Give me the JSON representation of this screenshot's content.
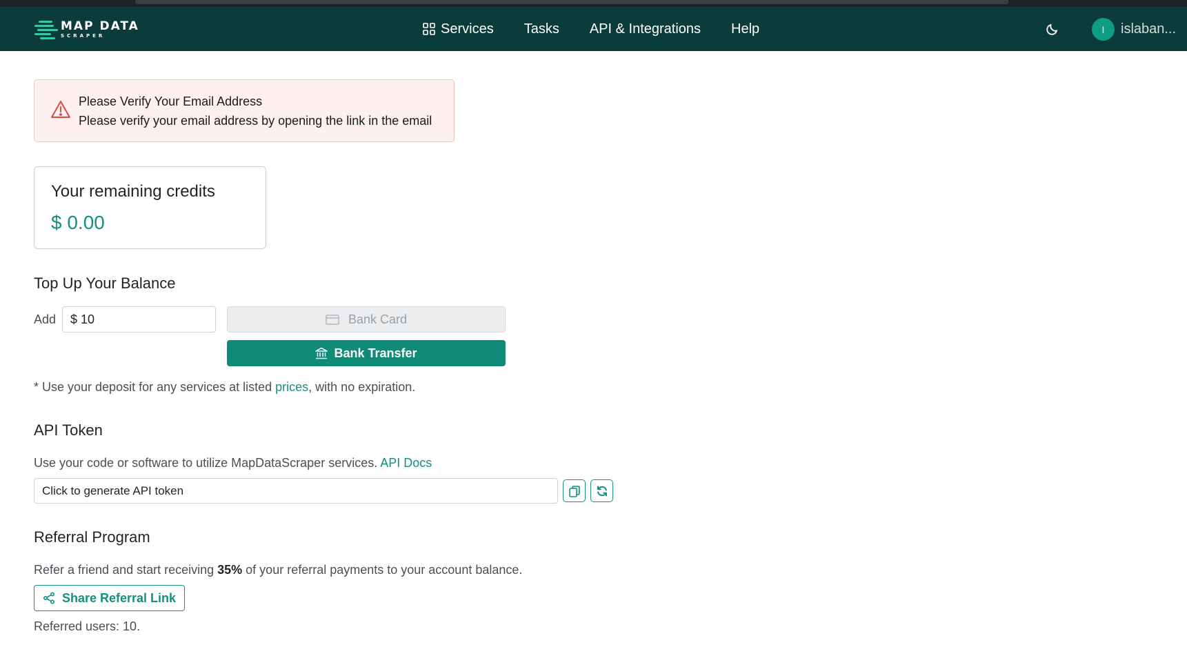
{
  "app": {
    "logo_title": "MAP DATA",
    "logo_subtitle": "SCRAPER"
  },
  "nav": {
    "items": [
      {
        "label": "Services",
        "icon": "grid-icon"
      },
      {
        "label": "Tasks"
      },
      {
        "label": "API & Integrations"
      },
      {
        "label": "Help"
      }
    ],
    "theme_icon": "moon-icon",
    "avatar_initial": "I",
    "username": "islaban..."
  },
  "alert": {
    "icon": "warning-triangle-icon",
    "title": "Please Verify Your Email Address",
    "message": "Please verify your email address by opening the link in the email"
  },
  "credits": {
    "title": "Your remaining credits",
    "amount": "$ 0.00"
  },
  "topup": {
    "heading": "Top Up Your Balance",
    "add_label": "Add",
    "currency": "$",
    "amount_value": "10",
    "bank_card_label": "Bank Card",
    "bank_transfer_label": "Bank Transfer",
    "note_prefix": "* Use your deposit for any services at listed ",
    "note_link": "prices",
    "note_suffix": ", with no expiration."
  },
  "api": {
    "heading": "API Token",
    "desc_prefix": "Use your code or software to utilize MapDataScraper services. ",
    "docs_link": "API Docs",
    "token_placeholder": "Click to generate API token",
    "copy_icon": "copy-icon",
    "refresh_icon": "refresh-icon"
  },
  "referral": {
    "heading": "Referral Program",
    "desc_prefix": "Refer a friend and start receiving ",
    "percent": "35%",
    "desc_suffix": " of your referral payments to your account balance.",
    "share_label": "Share Referral Link",
    "referred_text": "Referred users: 10."
  },
  "colors": {
    "navbar": "#0b3c3b",
    "accent": "#14907c",
    "button_primary": "#0f8b77",
    "alert_bg": "#fdf0ef",
    "alert_icon": "#d9534f"
  }
}
